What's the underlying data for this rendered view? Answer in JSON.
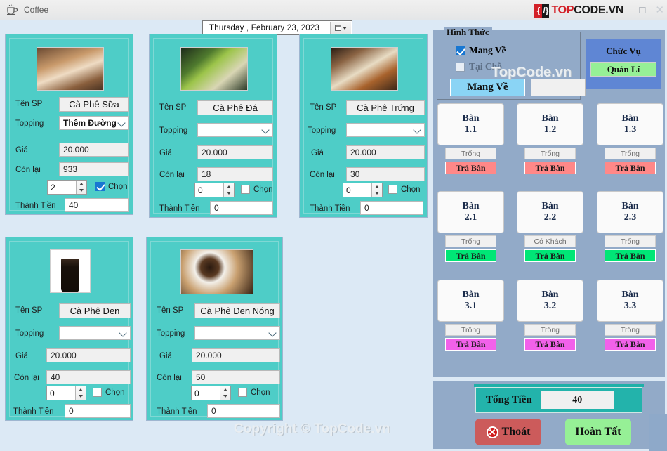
{
  "window": {
    "title": "Coffee",
    "app_icon": "coffee-cup-icon",
    "minimize": "",
    "maximize": "□",
    "close": "✕",
    "logo": {
      "mark_left": "{",
      "mark_right": "/}",
      "text_red": "TOP",
      "text_black": "CODE.VN"
    }
  },
  "datepicker": {
    "value": "Thursday  ,  February  23, 2023"
  },
  "labels": {
    "ten_sp": "Tên SP",
    "topping": "Topping",
    "gia": "Giá",
    "con_lai": "Còn lại",
    "chon": "Chọn",
    "thanh_tien": "Thành Tiền"
  },
  "products": [
    {
      "image": "iced-milk-coffee-photo",
      "name": "Cà Phê Sữa",
      "topping": "Thêm Đường",
      "price": "20.000",
      "remaining": "933",
      "qty": "2",
      "selected": true,
      "amount": "40"
    },
    {
      "image": "iced-black-coffee-photo",
      "name": "Cà Phê Đá",
      "topping": "",
      "price": "20.000",
      "remaining": "18",
      "qty": "0",
      "selected": false,
      "amount": "0"
    },
    {
      "image": "egg-coffee-photo",
      "name": "Cà Phê Trứng",
      "topping": "",
      "price": "20.000",
      "remaining": "30",
      "qty": "0",
      "selected": false,
      "amount": "0"
    },
    {
      "image": "black-coffee-glass-photo",
      "name": "Cà Phê Đen",
      "topping": "",
      "price": "20.000",
      "remaining": "40",
      "qty": "0",
      "selected": false,
      "amount": "0"
    },
    {
      "image": "hot-black-coffee-photo",
      "name": "Cà Phê Đen Nóng",
      "topping": "",
      "price": "20.000",
      "remaining": "50",
      "qty": "0",
      "selected": false,
      "amount": "0"
    }
  ],
  "order_type": {
    "group_title": "Hình Thức",
    "options": [
      {
        "label": "Mang Về",
        "checked": true
      },
      {
        "label": "Tại Chỗ",
        "checked": false
      }
    ],
    "selected_display": "Mang Về",
    "secondary_value": ""
  },
  "role": {
    "title": "Chức Vụ",
    "value": "Quản Lí"
  },
  "tables": [
    {
      "name": "Bàn",
      "number": "1.1",
      "status": "Trống",
      "action": "Trả Bàn",
      "action_color": "#ff8888"
    },
    {
      "name": "Bàn",
      "number": "1.2",
      "status": "Trống",
      "action": "Trả Bàn",
      "action_color": "#ff8888"
    },
    {
      "name": "Bàn",
      "number": "1.3",
      "status": "Trống",
      "action": "Trả Bàn",
      "action_color": "#ff8888"
    },
    {
      "name": "Bàn",
      "number": "2.1",
      "status": "Trống",
      "action": "Trả Bàn",
      "action_color": "#00e676"
    },
    {
      "name": "Bàn",
      "number": "2.2",
      "status": "Có Khách",
      "action": "Trả Bàn",
      "action_color": "#00e676"
    },
    {
      "name": "Bàn",
      "number": "2.3",
      "status": "Trống",
      "action": "Trả Bàn",
      "action_color": "#00e676"
    },
    {
      "name": "Bàn",
      "number": "3.1",
      "status": "Trống",
      "action": "Trả Bàn",
      "action_color": "#f261ea"
    },
    {
      "name": "Bàn",
      "number": "3.2",
      "status": "Trống",
      "action": "Trả Bàn",
      "action_color": "#f261ea"
    },
    {
      "name": "Bàn",
      "number": "3.3",
      "status": "Trống",
      "action": "Trả Bàn",
      "action_color": "#f261ea"
    }
  ],
  "totals": {
    "label": "Tổng Tiền",
    "value": "40",
    "exit_label": "Thoát",
    "done_label": "Hoàn Tất"
  },
  "watermarks": {
    "middle": "TopCode.vn",
    "bottom": "Copyright © TopCode.vn"
  },
  "colors": {
    "card_teal": "#4ecdc7",
    "panel_blue": "#92aac8",
    "background": "#dce9f5",
    "accent_blue": "#5f86d4",
    "total_teal": "#23b3ab"
  }
}
